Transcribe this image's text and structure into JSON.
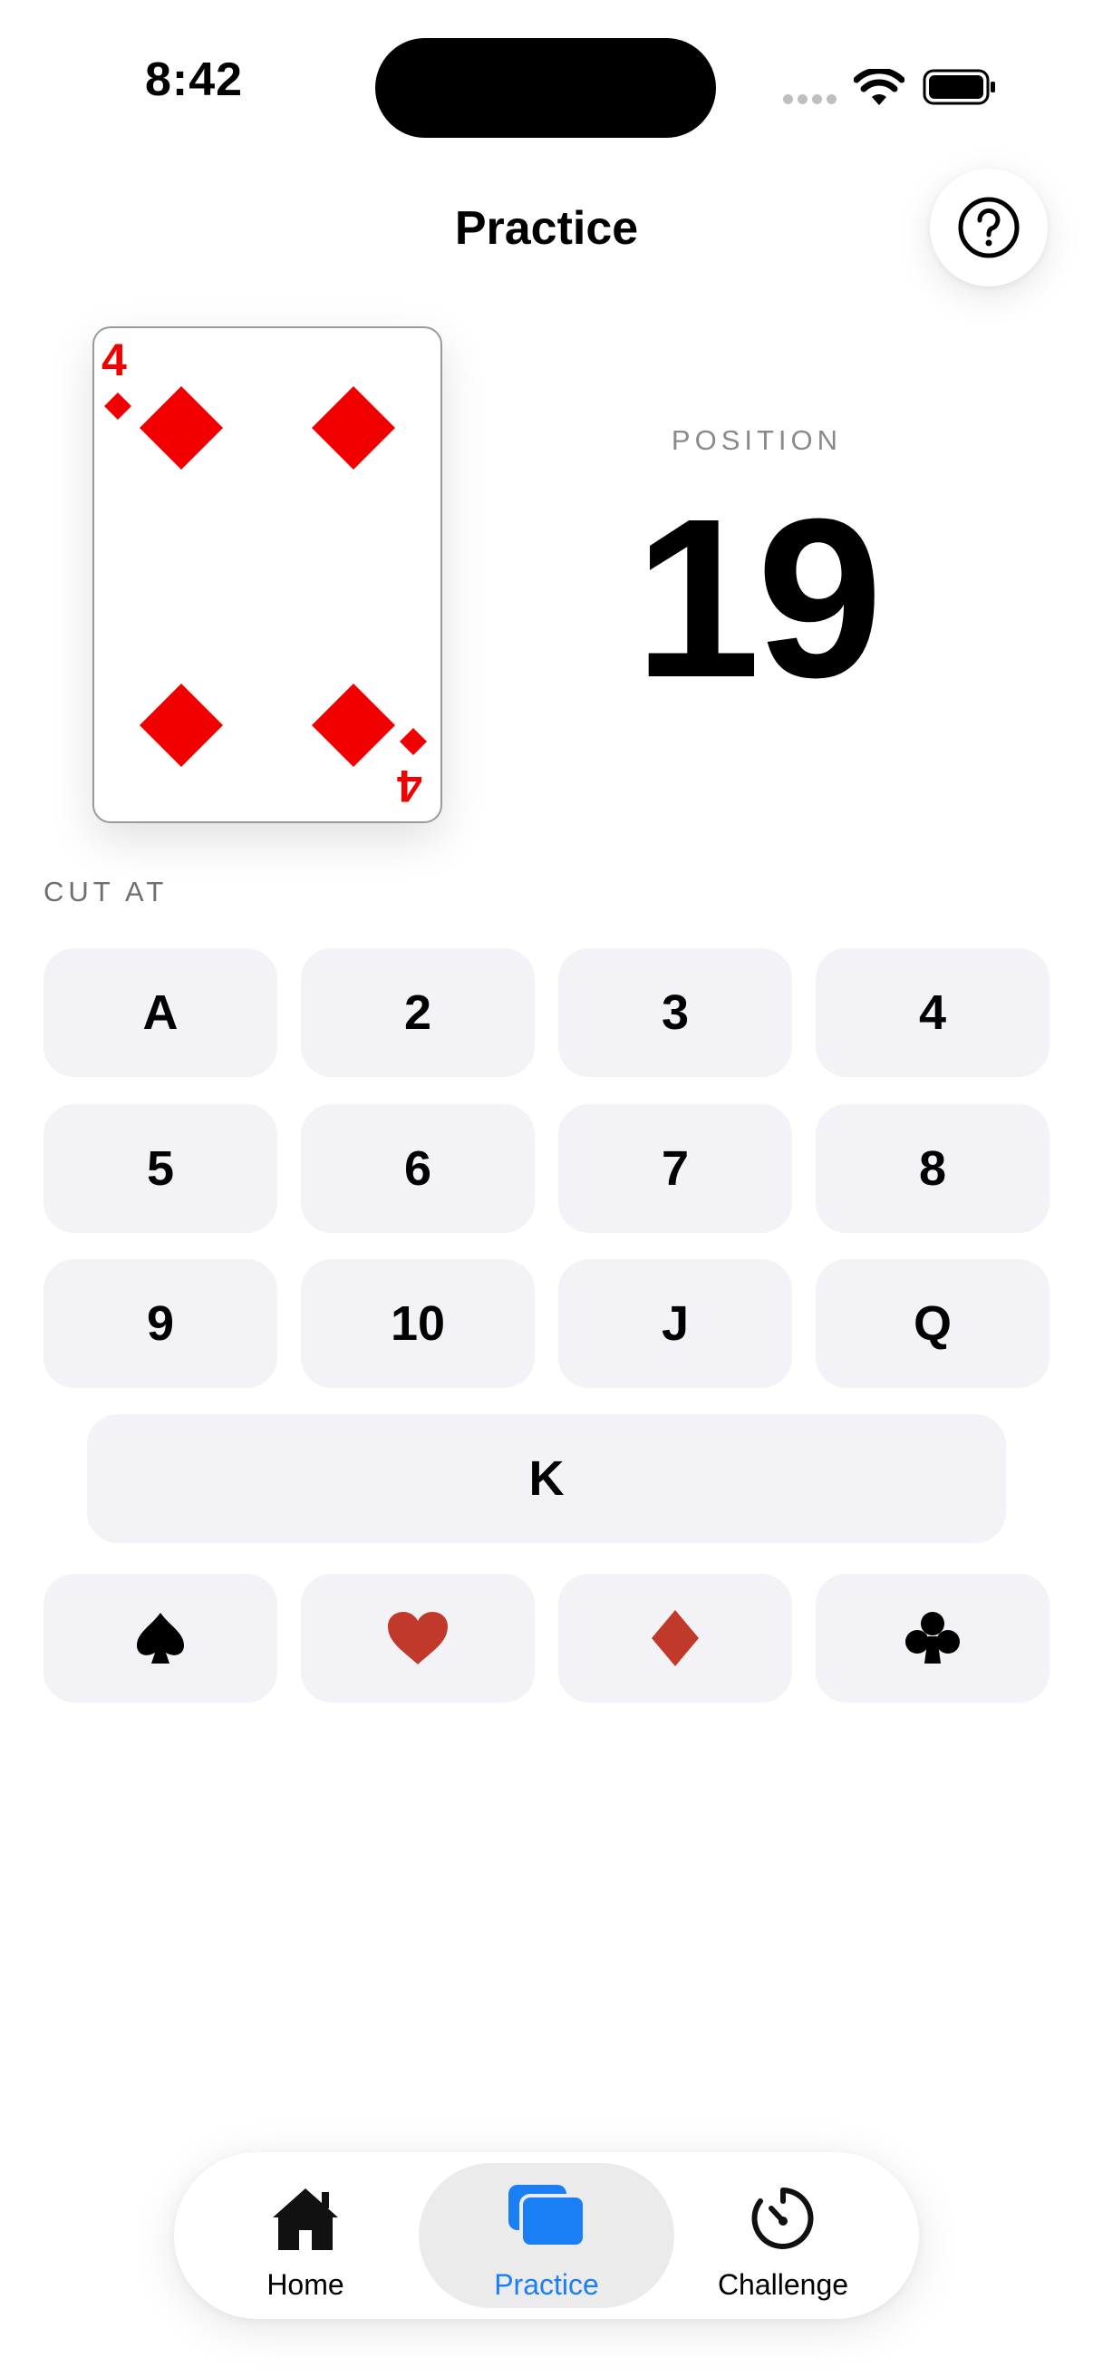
{
  "status": {
    "time": "8:42"
  },
  "header": {
    "title": "Practice"
  },
  "card": {
    "rank": "4",
    "suit": "diamond",
    "color": "#f20000"
  },
  "position": {
    "label": "POSITION",
    "value": "19"
  },
  "cut": {
    "label": "CUT AT",
    "ranks": [
      "A",
      "2",
      "3",
      "4",
      "5",
      "6",
      "7",
      "8",
      "9",
      "10",
      "J",
      "Q",
      "K"
    ],
    "suits": [
      {
        "name": "spade-icon",
        "color": "#000000"
      },
      {
        "name": "heart-icon",
        "color": "#c0392b"
      },
      {
        "name": "diamond-icon",
        "color": "#c0392b"
      },
      {
        "name": "club-icon",
        "color": "#000000"
      }
    ]
  },
  "tabs": [
    {
      "label": "Home",
      "icon": "home-icon",
      "active": false
    },
    {
      "label": "Practice",
      "icon": "cards-icon",
      "active": true
    },
    {
      "label": "Challenge",
      "icon": "timer-icon",
      "active": false
    }
  ],
  "colors": {
    "accent": "#1a7ef5",
    "key_bg": "#f2f2f7"
  }
}
